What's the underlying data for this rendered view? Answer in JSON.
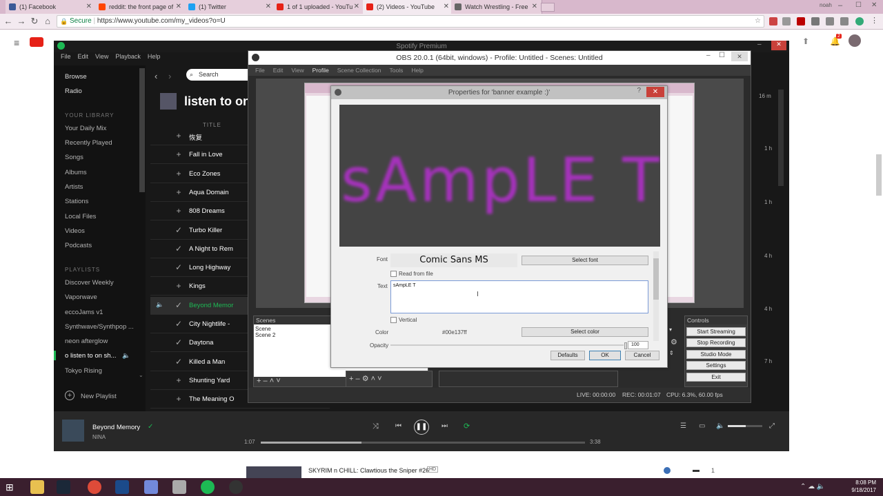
{
  "browser": {
    "tabs": [
      {
        "label": "(1) Facebook",
        "color": "#3b5998"
      },
      {
        "label": "reddit: the front page of",
        "color": "#ff4500"
      },
      {
        "label": "(1) Twitter",
        "color": "#1da1f2"
      },
      {
        "label": "1 of 1 uploaded - YouTu",
        "color": "#e62117"
      },
      {
        "label": "(2) Videos - YouTube",
        "color": "#e62117"
      },
      {
        "label": "Watch Wrestling - Free",
        "color": "#666"
      }
    ],
    "user": "noah",
    "secure_label": "Secure",
    "url": "https://www.youtube.com/my_videos?o=U",
    "notif_count": "2"
  },
  "spotify": {
    "title": "Spotify Premium",
    "menu": [
      "File",
      "Edit",
      "View",
      "Playback",
      "Help"
    ],
    "nav": [
      "Browse",
      "Radio"
    ],
    "library_head": "YOUR LIBRARY",
    "library": [
      "Your Daily Mix",
      "Recently Played",
      "Songs",
      "Albums",
      "Artists",
      "Stations",
      "Local Files",
      "Videos",
      "Podcasts"
    ],
    "playlists_head": "PLAYLISTS",
    "playlists": [
      "Discover Weekly",
      "Vaporwave",
      "eccoJams v1",
      "Synthwave/Synthpop ...",
      "neon afterglow",
      "listen to on sh...",
      "Tokyo Rising"
    ],
    "new_playlist": "New Playlist",
    "search_placeholder": "Search",
    "playlist_title": "listen to on",
    "col_title": "TITLE",
    "tracks": [
      {
        "name": "恢复",
        "icon": "+"
      },
      {
        "name": "Fall in Love",
        "icon": "+"
      },
      {
        "name": "Eco Zones",
        "icon": "+"
      },
      {
        "name": "Aqua Domain",
        "icon": "+"
      },
      {
        "name": "808 Dreams",
        "icon": "+"
      },
      {
        "name": "Turbo Killer",
        "icon": "✓"
      },
      {
        "name": "A Night to Rem",
        "icon": "✓"
      },
      {
        "name": "Long Highway",
        "icon": "✓"
      },
      {
        "name": "Kings",
        "icon": "+"
      },
      {
        "name": "Beyond Memor",
        "icon": "✓",
        "playing": true
      },
      {
        "name": "City Nightlife -",
        "icon": "✓"
      },
      {
        "name": "Daytona",
        "icon": "✓"
      },
      {
        "name": "Killed a Man",
        "icon": "✓"
      },
      {
        "name": "Shunting Yard",
        "icon": "+"
      },
      {
        "name": "The Meaning O",
        "icon": "+"
      }
    ],
    "durations": [
      "16 m",
      "1 h",
      "1 h",
      "4 h",
      "4 h",
      "7 h"
    ],
    "now_playing": {
      "title": "Beyond Memory",
      "artist": "NINA",
      "elapsed": "1:07",
      "total": "3:38",
      "progress": 0.31
    }
  },
  "obs": {
    "title": "OBS 20.0.1 (64bit, windows) - Profile: Untitled - Scenes: Untitled",
    "menu": [
      "File",
      "Edit",
      "View",
      "Profile",
      "Scene Collection",
      "Tools",
      "Help"
    ],
    "scenes_head": "Scenes",
    "scenes": [
      "Scene",
      "Scene 2"
    ],
    "controls_head": "Controls",
    "controls": [
      "Start Streaming",
      "Stop Recording",
      "Studio Mode",
      "Settings",
      "Exit"
    ],
    "status": {
      "live": "LIVE: 00:00:00",
      "rec": "REC: 00:01:07",
      "cpu": "CPU: 6.3%, 60.00 fps"
    }
  },
  "props": {
    "title": "Properties for 'banner example :)'",
    "preview_text": "sAmpLE T",
    "font_label": "Font",
    "font_value": "Comic Sans MS",
    "select_font": "Select font",
    "read_from_file": "Read from file",
    "text_label": "Text",
    "text_value": "sAmpLE T",
    "vertical": "Vertical",
    "color_label": "Color",
    "color_value": "#00e137ff",
    "select_color": "Select color",
    "opacity_label": "Opacity",
    "opacity_value": "100",
    "defaults": "Defaults",
    "ok": "OK",
    "cancel": "Cancel"
  },
  "youtube": {
    "video_title": "SKYRIM n CHILL: Clawtious the Sniper #26",
    "hd": "HD",
    "comments": "1"
  },
  "taskbar": {
    "time": "8:08 PM",
    "date": "9/18/2017"
  }
}
